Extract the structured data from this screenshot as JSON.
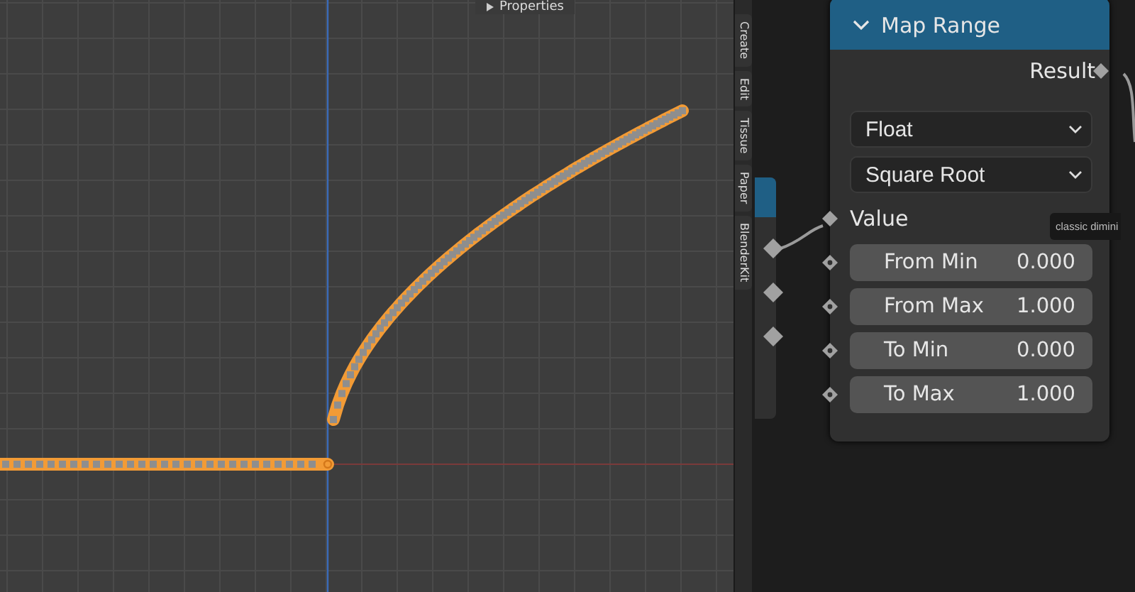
{
  "graph_editor": {
    "header": "Properties",
    "tabs": [
      {
        "label": "Create"
      },
      {
        "label": "Edit"
      },
      {
        "label": "Tissue"
      },
      {
        "label": "Paper"
      },
      {
        "label": "BlenderKit"
      }
    ]
  },
  "node_editor": {
    "map_range": {
      "title": "Map Range",
      "expanded": true,
      "output": "Result",
      "data_type": "Float",
      "interpolation": "Square Root",
      "input": "Value",
      "fields": [
        {
          "label": "From Min",
          "value": "0.000"
        },
        {
          "label": "From Max",
          "value": "1.000"
        },
        {
          "label": "To Min",
          "value": "0.000"
        },
        {
          "label": "To Max",
          "value": "1.000"
        }
      ]
    },
    "tooltip": "classic dimini"
  }
}
